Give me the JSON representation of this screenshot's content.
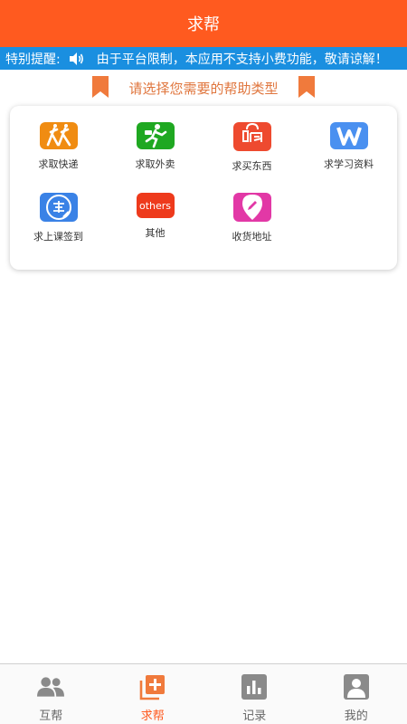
{
  "header": {
    "title": "求帮"
  },
  "notice": {
    "label": "特别提醒:",
    "message": "由于平台限制，本应用不支持小费功能，敬请谅解！",
    "icon": "speaker-icon"
  },
  "section": {
    "heading": "请选择您需要的帮助类型"
  },
  "categories": [
    {
      "label": "求取快递",
      "icon": "express-icon",
      "color": "#f08c12"
    },
    {
      "label": "求取外卖",
      "icon": "takeout-icon",
      "color": "#1fa821"
    },
    {
      "label": "求买东西",
      "icon": "shopping-icon",
      "color": "#ee4a2f"
    },
    {
      "label": "求学习资料",
      "icon": "study-material-icon",
      "color": "#4a90f0"
    },
    {
      "label": "求上课签到",
      "icon": "sign-in-icon",
      "color": "#3a82e6"
    },
    {
      "label": "其他",
      "icon": "others-icon",
      "color": "#ee3a1c",
      "badge": "others"
    },
    {
      "label": "收货地址",
      "icon": "location-pin-icon",
      "color": "#e238a6"
    }
  ],
  "tabs": [
    {
      "label": "互帮",
      "icon": "people-icon",
      "active": false
    },
    {
      "label": "求帮",
      "icon": "add-request-icon",
      "active": true
    },
    {
      "label": "记录",
      "icon": "chart-icon",
      "active": false
    },
    {
      "label": "我的",
      "icon": "profile-icon",
      "active": false
    }
  ],
  "colors": {
    "brand": "#ff5a1f",
    "notice_bg": "#1a8fe0",
    "heading": "#e0763e"
  }
}
